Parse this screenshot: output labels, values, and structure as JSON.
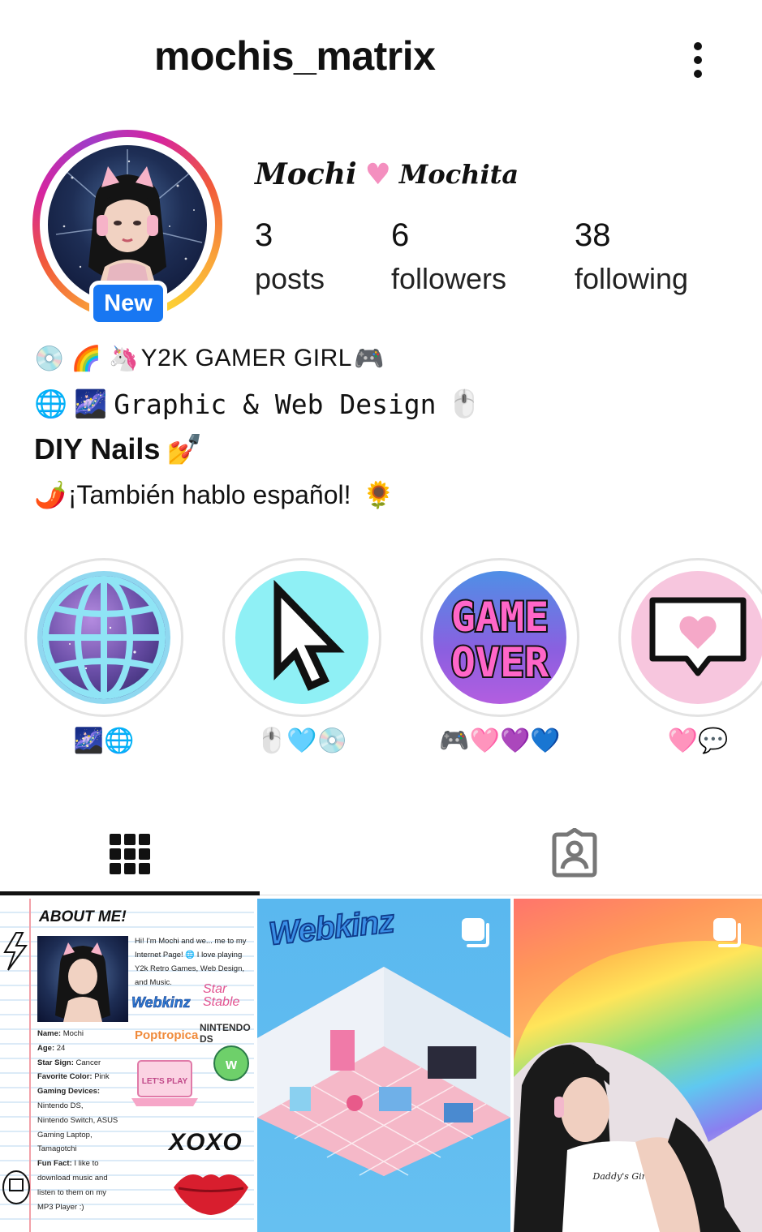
{
  "header": {
    "username": "mochis_matrix"
  },
  "profile": {
    "display_name_left": "Mochi",
    "display_name_right": "Mochita",
    "new_badge": "New",
    "stats": [
      {
        "value": "3",
        "label": "posts"
      },
      {
        "value": "6",
        "label": "followers"
      },
      {
        "value": "38",
        "label": "following"
      }
    ]
  },
  "bio": {
    "line1": "Y2K GAMER GIRL",
    "line2": "Graphic & Web Design",
    "line3": "DIY Nails",
    "line4": "¡También hablo español!"
  },
  "highlights": [
    {
      "label_emojis": "🌌🌐",
      "cover": "globe"
    },
    {
      "label_emojis": "🖱️🩵💿",
      "cover": "cursor"
    },
    {
      "label_emojis": "🎮🩷💜💙",
      "cover": "game-over"
    },
    {
      "label_emojis": "🩷💬",
      "cover": "heart-bubble"
    }
  ],
  "highlight_cover_text": {
    "game_over_line1": "GAME",
    "game_over_line2": "OVER"
  },
  "tabs": {
    "active": "grid"
  },
  "posts": {
    "about": {
      "title": "ABOUT ME!",
      "intro": "Hi! I'm Mochi and we... me to my Internet Page! 🌐 I love playing Y2k Retro Games, Web Design, and Music.",
      "facts": [
        {
          "key": "Name:",
          "value": "Mochi"
        },
        {
          "key": "Age:",
          "value": "24"
        },
        {
          "key": "Star Sign:",
          "value": "Cancer"
        },
        {
          "key": "Favorite Color:",
          "value": "Pink"
        },
        {
          "key": "Gaming Devices:",
          "value": ""
        },
        {
          "key": "",
          "value": "Nintendo DS,"
        },
        {
          "key": "",
          "value": "Nintendo Switch, ASUS"
        },
        {
          "key": "",
          "value": "Gaming Laptop,"
        },
        {
          "key": "",
          "value": "Tamagotchi"
        },
        {
          "key": "Fun Fact:",
          "value": "I like to"
        },
        {
          "key": "",
          "value": "download music and"
        },
        {
          "key": "",
          "value": "listen to them on my"
        },
        {
          "key": "",
          "value": "MP3 Player :)"
        }
      ],
      "logos": {
        "webkinz": "Webkinz",
        "star_stable": "Star Stable",
        "nintendo_ds": "NINTENDO DS",
        "poptropica": "Poptropica",
        "lets_play": "LET'S PLAY"
      },
      "signoff": "XOXO"
    },
    "webkinz": {
      "logo": "Webkinz"
    },
    "rainbow": {
      "shirt_text": "Daddy's Girl"
    }
  }
}
